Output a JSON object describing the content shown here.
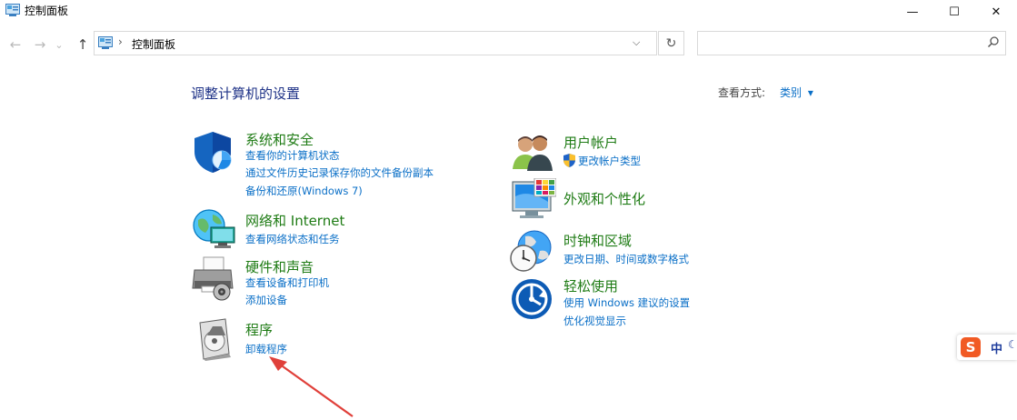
{
  "window": {
    "title": "控制面板",
    "minimize_glyph": "—",
    "maximize_glyph": "☐",
    "close_glyph": "✕"
  },
  "addressbar": {
    "separator": "›",
    "path": "控制面板",
    "dropdown_glyph": "⌵",
    "refresh_glyph": "↻",
    "search_placeholder": ""
  },
  "nav": {
    "back_glyph": "←",
    "forward_glyph": "→",
    "recent_glyph": "⌄",
    "up_glyph": "↑"
  },
  "main": {
    "heading": "调整计算机的设置",
    "view_by_label": "查看方式:",
    "view_by_value": "类别",
    "view_by_arrow": "▾"
  },
  "categories_left": [
    {
      "icon": "shield-icon",
      "title": "系统和安全",
      "links": [
        "查看你的计算机状态",
        "通过文件历史记录保存你的文件备份副本",
        "备份和还原(Windows 7)"
      ]
    },
    {
      "icon": "network-globe-icon",
      "title": "网络和 Internet",
      "links": [
        "查看网络状态和任务"
      ]
    },
    {
      "icon": "printer-icon",
      "title": "硬件和声音",
      "links": [
        "查看设备和打印机",
        "添加设备"
      ]
    },
    {
      "icon": "programs-disc-icon",
      "title": "程序",
      "links": [
        "卸载程序"
      ]
    }
  ],
  "categories_right": [
    {
      "icon": "users-icon",
      "title": "用户帐户",
      "links": [
        "更改帐户类型"
      ]
    },
    {
      "icon": "monitor-palette-icon",
      "title": "外观和个性化",
      "links": []
    },
    {
      "icon": "clock-globe-icon",
      "title": "时钟和区域",
      "links": [
        "更改日期、时间或数字格式"
      ]
    },
    {
      "icon": "ease-of-access-icon",
      "title": "轻松使用",
      "links": [
        "使用 Windows 建议的设置",
        "优化视觉显示"
      ]
    }
  ],
  "ime": {
    "logo_text": "S",
    "language": "中",
    "mode_glyph": "☾"
  },
  "colors": {
    "category_title": "#1e7b14",
    "link": "#0a6fc7",
    "heading": "#1e3287",
    "annotation_arrow": "#e0403a"
  }
}
